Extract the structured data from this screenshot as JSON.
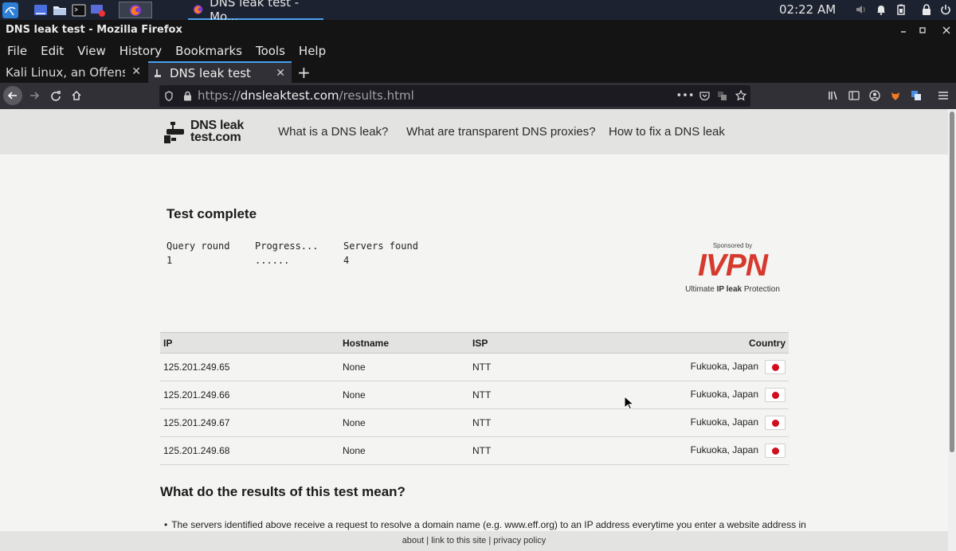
{
  "taskbar": {
    "window_title": "DNS leak test - Mo...",
    "clock": "02:22 AM"
  },
  "browser": {
    "window_title": "DNS leak test - Mozilla Firefox",
    "menu": [
      "File",
      "Edit",
      "View",
      "History",
      "Bookmarks",
      "Tools",
      "Help"
    ],
    "tabs": [
      {
        "label": "Kali Linux, an Offensive",
        "active": false
      },
      {
        "label": "DNS leak test",
        "active": true
      }
    ],
    "url": {
      "scheme": "https://",
      "host": "dnsleaktest.com",
      "path": "/results.html"
    }
  },
  "site": {
    "logo": {
      "line1": "DNS leak",
      "line2": "test.com"
    },
    "nav": [
      "What is a DNS leak?",
      "What are transparent DNS proxies?",
      "How to fix a DNS leak"
    ]
  },
  "test": {
    "heading": "Test complete",
    "stats": {
      "query_round_label": "Query round",
      "query_round_value": "1",
      "progress_label": "Progress...",
      "progress_value": "......",
      "servers_found_label": "Servers found",
      "servers_found_value": "4"
    }
  },
  "sponsor": {
    "label": "Sponsored by",
    "brand": "IVPN",
    "tagline_pre": "Ultimate ",
    "tagline_bold": "IP leak",
    "tagline_post": " Protection"
  },
  "results_table": {
    "columns": [
      "IP",
      "Hostname",
      "ISP",
      "Country"
    ],
    "rows": [
      {
        "ip": "125.201.249.65",
        "hostname": "None",
        "isp": "NTT",
        "country": "Fukuoka, Japan"
      },
      {
        "ip": "125.201.249.66",
        "hostname": "None",
        "isp": "NTT",
        "country": "Fukuoka, Japan"
      },
      {
        "ip": "125.201.249.67",
        "hostname": "None",
        "isp": "NTT",
        "country": "Fukuoka, Japan"
      },
      {
        "ip": "125.201.249.68",
        "hostname": "None",
        "isp": "NTT",
        "country": "Fukuoka, Japan"
      }
    ]
  },
  "results_explanation": {
    "heading": "What do the results of this test mean?",
    "bullet": "The servers identified above receive a request to resolve a domain name (e.g. www.eff.org) to an IP address everytime you enter a website address in"
  },
  "footer": {
    "links": [
      "about",
      "link to this site",
      "privacy policy"
    ],
    "separator": " | "
  },
  "colors": {
    "accent_tab": "#4aa0f0",
    "sponsor_red": "#d63a2e",
    "flag_red": "#d10d1e"
  }
}
